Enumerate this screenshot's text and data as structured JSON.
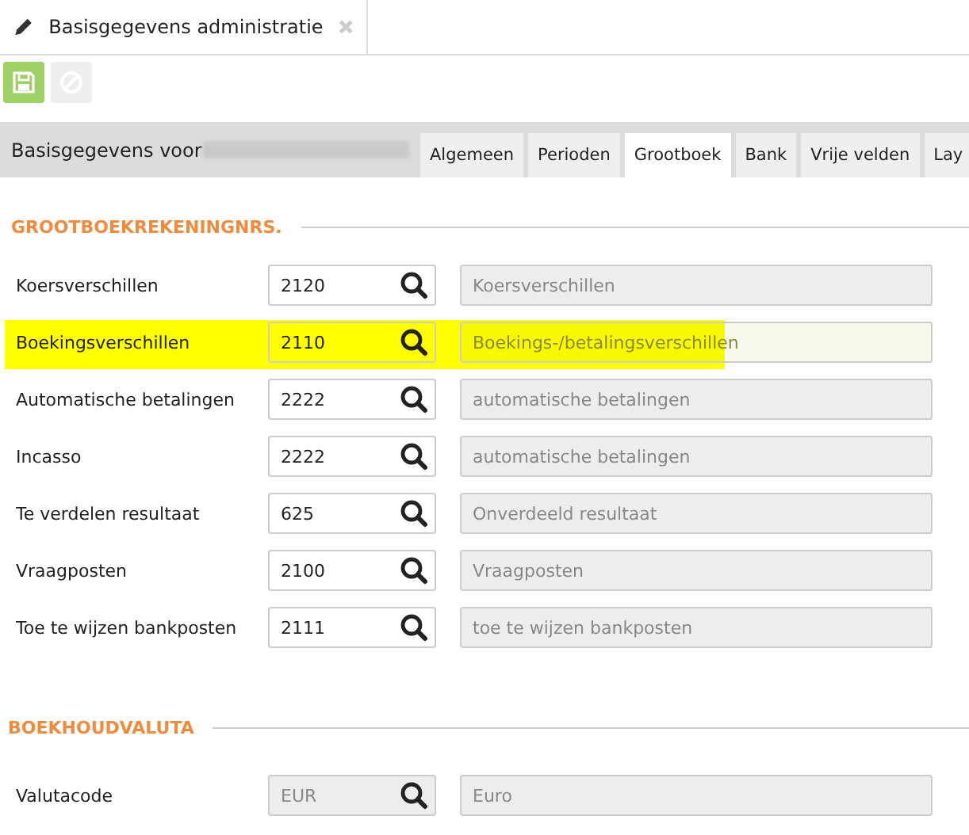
{
  "doc_tab": {
    "title": "Basisgegevens administratie"
  },
  "toolbar": {
    "save": {
      "disabled": false
    },
    "cancel": {
      "disabled": true
    }
  },
  "header": {
    "title": "Basisgegevens voor",
    "redacted": true
  },
  "tabs": [
    {
      "label": "Algemeen",
      "selected": false
    },
    {
      "label": "Perioden",
      "selected": false
    },
    {
      "label": "Grootboek",
      "selected": true
    },
    {
      "label": "Bank",
      "selected": false
    },
    {
      "label": "Vrije velden",
      "selected": false
    },
    {
      "label": "Lay",
      "selected": false
    }
  ],
  "sections": [
    {
      "title": "GROOTBOEKREKENINGNRS.",
      "rows": [
        {
          "label": "Koersverschillen",
          "code": "2120",
          "description": "Koersverschillen",
          "highlighted": false,
          "disabled": false
        },
        {
          "label": "Boekingsverschillen",
          "code": "2110",
          "description": "Boekings-/betalingsverschillen",
          "highlighted": true,
          "disabled": false
        },
        {
          "label": "Automatische betalingen",
          "code": "2222",
          "description": "automatische betalingen",
          "highlighted": false,
          "disabled": false
        },
        {
          "label": "Incasso",
          "code": "2222",
          "description": "automatische betalingen",
          "highlighted": false,
          "disabled": false
        },
        {
          "label": "Te verdelen resultaat",
          "code": "625",
          "description": "Onverdeeld resultaat",
          "highlighted": false,
          "disabled": false
        },
        {
          "label": "Vraagposten",
          "code": "2100",
          "description": "Vraagposten",
          "highlighted": false,
          "disabled": false
        },
        {
          "label": "Toe te wijzen bankposten",
          "code": "2111",
          "description": "toe te wijzen bankposten",
          "highlighted": false,
          "disabled": false
        }
      ]
    },
    {
      "title": "BOEKHOUDVALUTA",
      "rows": [
        {
          "label": "Valutacode",
          "code": "EUR",
          "description": "Euro",
          "highlighted": false,
          "disabled": true
        }
      ]
    }
  ]
}
